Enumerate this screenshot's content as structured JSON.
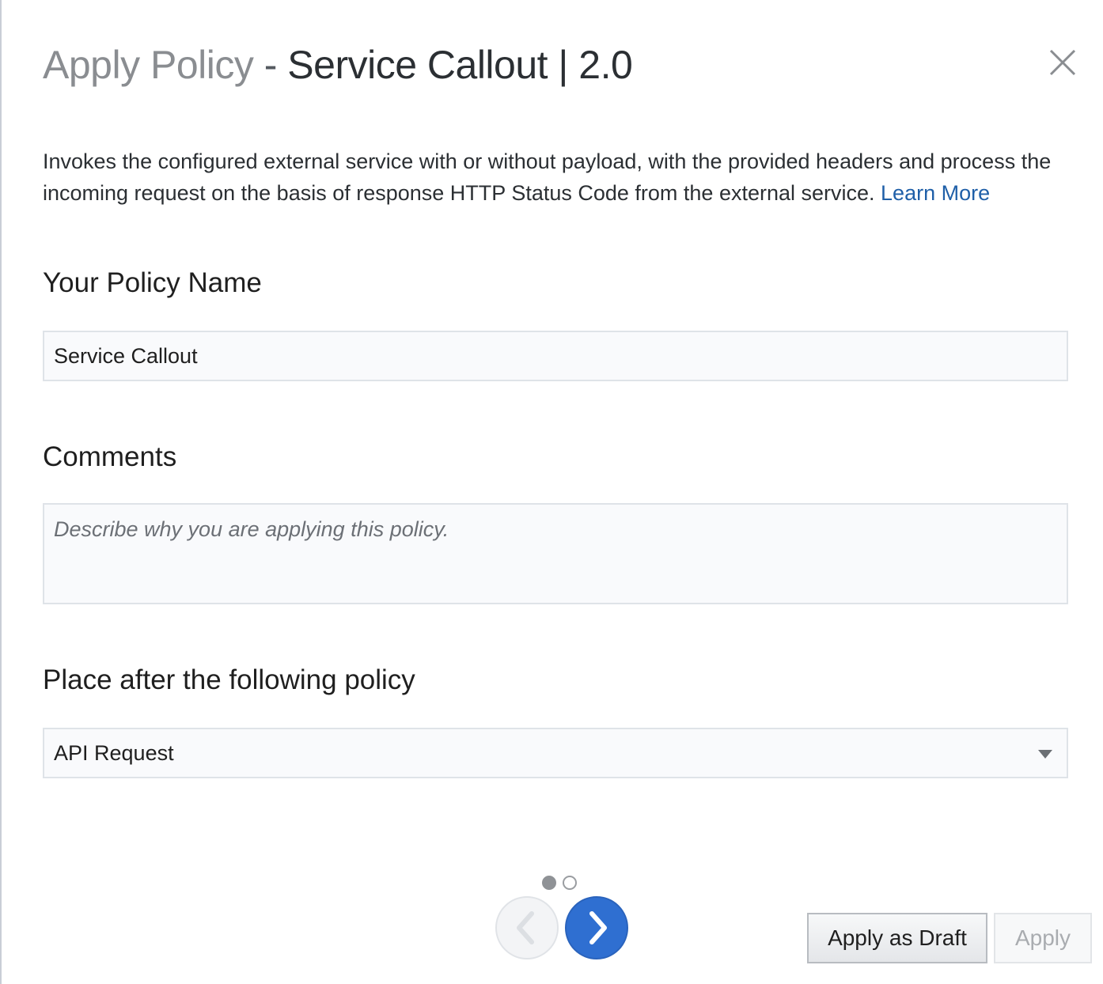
{
  "dialog": {
    "title_prefix": "Apply Policy",
    "title_separator": " - ",
    "title_name": "Service Callout | 2.0",
    "close_icon": "close-icon"
  },
  "description": {
    "text": "Invokes the configured external service with or without payload, with the provided headers and process the incoming request on the basis of response HTTP Status Code from the external service. ",
    "link_text": "Learn More"
  },
  "policy_name": {
    "label": "Your Policy Name",
    "value": "Service Callout"
  },
  "comments": {
    "label": "Comments",
    "placeholder": "Describe why you are applying this policy."
  },
  "placement": {
    "label": "Place after the following policy",
    "selected": "API Request"
  },
  "pager": {
    "current_page": 1,
    "total_pages": 2
  },
  "buttons": {
    "prev_icon": "chevron-left-icon",
    "next_icon": "chevron-right-icon",
    "apply_as_draft": "Apply as Draft",
    "apply": "Apply"
  },
  "colors": {
    "link": "#1f5fa8",
    "next_button": "#2f6fd1",
    "disabled_text": "#a9acb0"
  }
}
